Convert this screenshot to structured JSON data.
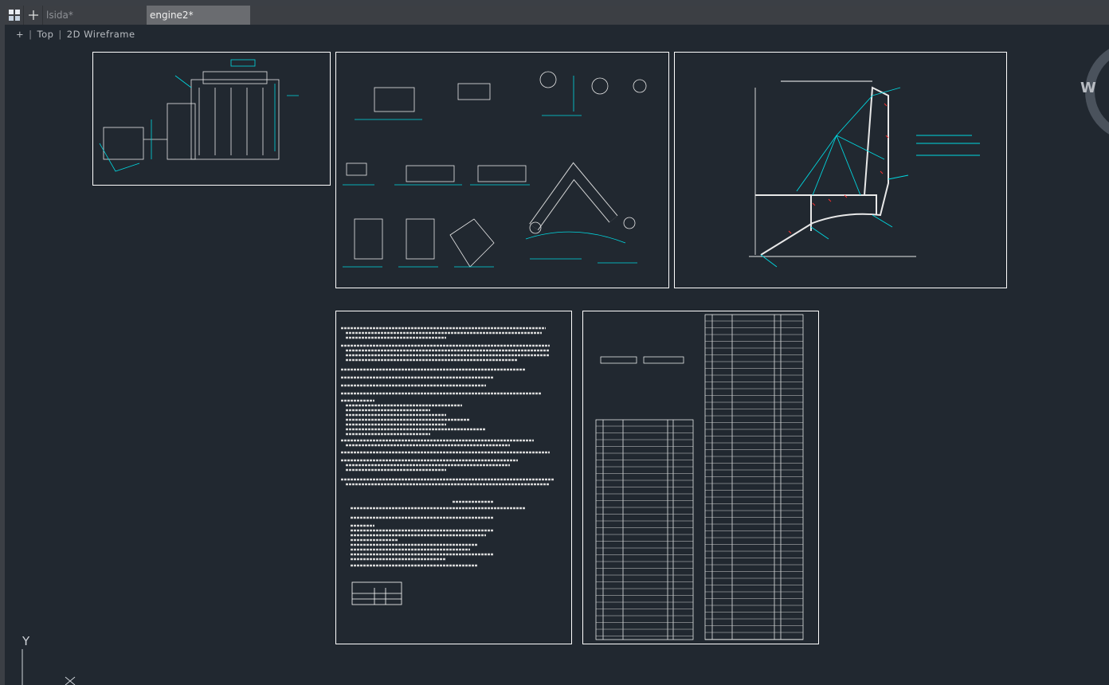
{
  "tabs": [
    {
      "label": "lsida*",
      "active": false
    },
    {
      "label": "engine2*",
      "active": true
    }
  ],
  "viewport": {
    "plus": "+",
    "view": "Top",
    "style": "2D Wireframe"
  },
  "viewcube": {
    "west": "W"
  },
  "ucs": {
    "y": "Y",
    "x": "X"
  },
  "colors": {
    "background": "#212830",
    "sheet_border": "#ffffff",
    "drawing_accent": "#00d8e0",
    "annotation_red": "#ff3030"
  },
  "icons": {
    "layout": "grid-icon",
    "new_tab": "plus-icon"
  }
}
